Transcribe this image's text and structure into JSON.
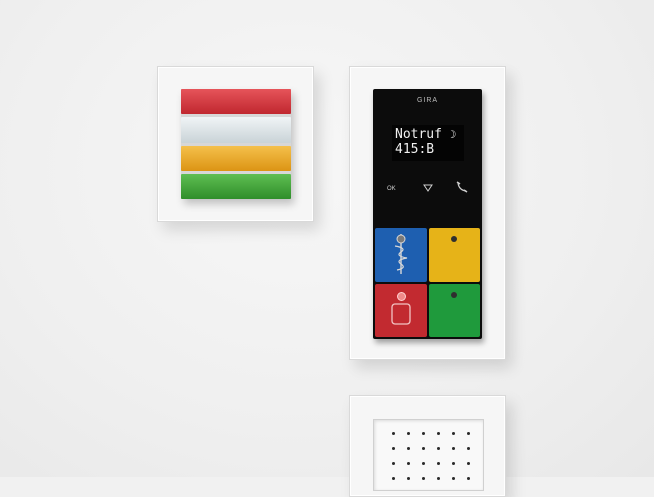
{
  "scene": {
    "objects": [
      {
        "name": "signal light unit",
        "segments": [
          "red",
          "white",
          "amber",
          "green"
        ]
      },
      {
        "name": "call panel"
      },
      {
        "name": "speaker grille"
      }
    ]
  },
  "panel": {
    "brand": "GIRA",
    "display_line1": "Notruf ",
    "display_line2": "415:B",
    "ok_label": "OK",
    "keys": [
      {
        "color": "#1e5fb0",
        "icon": "caduceus-icon"
      },
      {
        "color": "#e6b318",
        "icon": "led-dot"
      },
      {
        "color": "#c22a30",
        "icon": "person-icon"
      },
      {
        "color": "#1f9a3c",
        "icon": "led-dot"
      }
    ]
  },
  "colors": {
    "wall": "#f1f1f1",
    "frame": "#f6f6f6",
    "panel": "#0c0c0c"
  }
}
